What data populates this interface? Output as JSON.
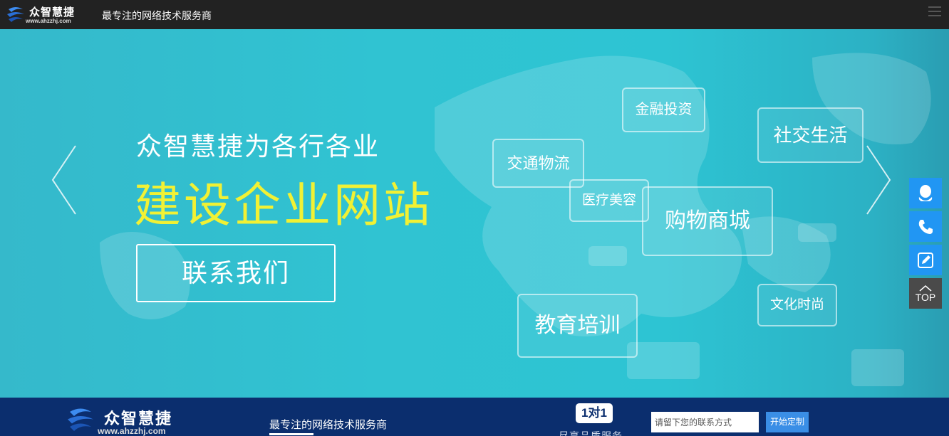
{
  "header": {
    "brand": "众智慧捷",
    "url": "www.ahzzhj.com",
    "slogan": "最专注的网络技术服务商"
  },
  "banner": {
    "headline": "众智慧捷为各行各业",
    "headline_big": "建设企业网站",
    "contact_button": "联系我们",
    "tags": {
      "finance": "金融投资",
      "social": "社交生活",
      "transport": "交通物流",
      "medical": "医疗美容",
      "shopping": "购物商城",
      "education": "教育培训",
      "fashion": "文化时尚"
    },
    "accent_color": "#f1f134"
  },
  "sidebar": {
    "top_label": "TOP"
  },
  "footer_bar": {
    "brand": "众智慧捷",
    "url": "www.ahzzhj.com",
    "slogan": "最专注的网络技术服务商",
    "badge": "1对1",
    "badge_caption": "尽享品质服务",
    "input_placeholder": "请留下您的联系方式",
    "submit_label": "开始定制"
  }
}
